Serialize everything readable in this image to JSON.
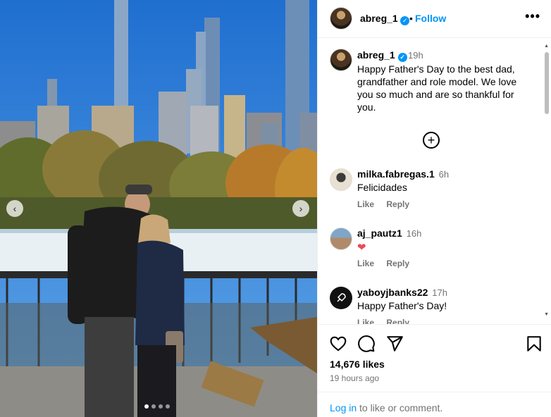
{
  "post": {
    "username": "abreg_1",
    "follow_label": "Follow",
    "separator": "•",
    "more_label": "•••",
    "verified_mark": "✓"
  },
  "caption": {
    "username": "abreg_1",
    "time": "19h",
    "text": "Happy Father's Day to the best dad, grandfather and role model. We love you so much and are so thankful for you."
  },
  "add_comment_symbol": "+",
  "comments": [
    {
      "username": "milka.fabregas.1",
      "time": "6h",
      "text": "Felicidades",
      "like": "Like",
      "reply": "Reply"
    },
    {
      "username": "aj_pautz1",
      "time": "16h",
      "text": "",
      "emoji": "❤",
      "like": "Like",
      "reply": "Reply"
    },
    {
      "username": "yaboyjbanks22",
      "time": "17h",
      "text": "Happy Father's Day!",
      "like": "Like",
      "reply": "Reply"
    }
  ],
  "footer": {
    "likes": "14,676 likes",
    "ago": "19 hours ago",
    "login_link": "Log in",
    "login_rest": " to like or comment."
  },
  "carousel": {
    "prev": "‹",
    "next": "›",
    "total_slides": 4,
    "active_slide": 1
  },
  "colors": {
    "accent": "#0095f6",
    "muted": "#737373",
    "heart": "#ed4956"
  },
  "icons": [
    "heart-icon",
    "comment-icon",
    "share-icon",
    "bookmark-icon",
    "more-icon",
    "add-icon",
    "verified-icon"
  ]
}
